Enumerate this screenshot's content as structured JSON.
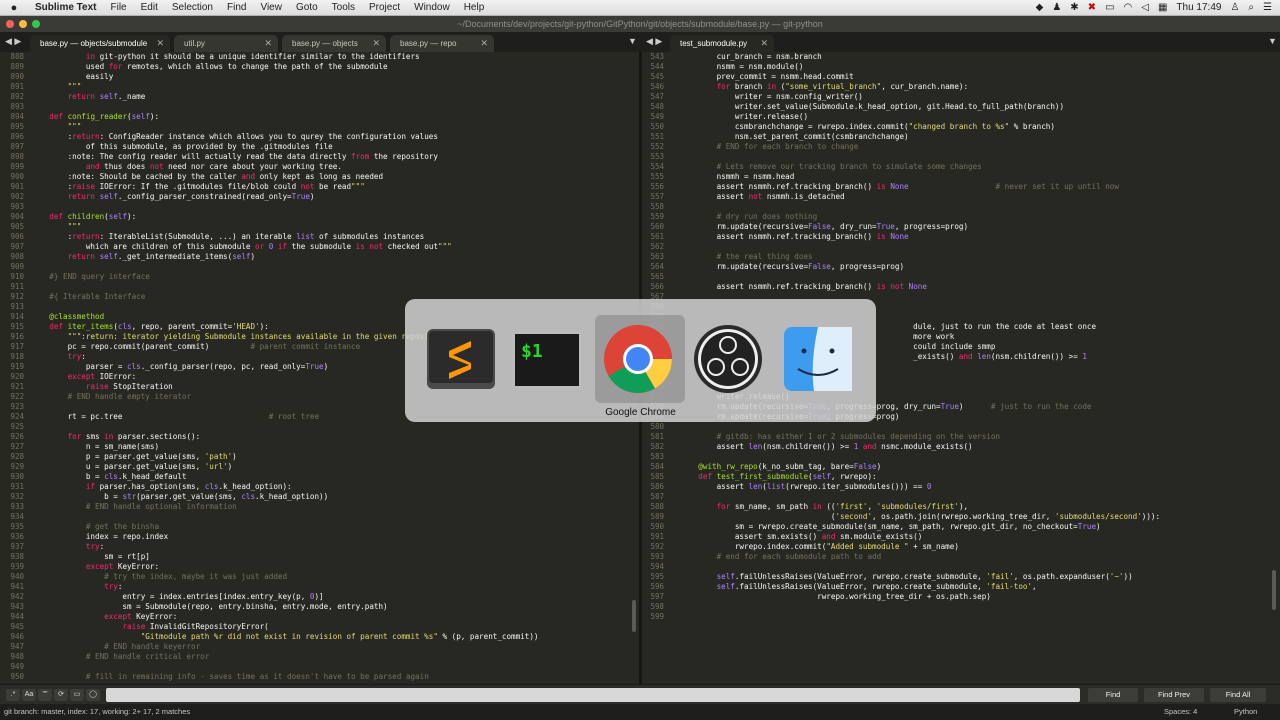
{
  "menubar": {
    "app": "Sublime Text",
    "items": [
      "File",
      "Edit",
      "Selection",
      "Find",
      "View",
      "Goto",
      "Tools",
      "Project",
      "Window",
      "Help"
    ],
    "clock": "Thu 17:49"
  },
  "window": {
    "title": "~/Documents/dev/projects/git-python/GitPython/git/objects/submodule/base.py — git-python"
  },
  "tabs_left": [
    {
      "label": "base.py — objects/submodule"
    },
    {
      "label": "util.py"
    },
    {
      "label": "base.py — objects"
    },
    {
      "label": "base.py — repo"
    }
  ],
  "tabs_right": [
    {
      "label": "test_submodule.py"
    }
  ],
  "left_lines": [
    {
      "n": "888",
      "t": "            in git-python it should be a unique identifier similar to the identifiers"
    },
    {
      "n": "889",
      "t": "            used for remotes, which allows to change the path of the submodule"
    },
    {
      "n": "890",
      "t": "            easily"
    },
    {
      "n": "891",
      "t": "        \"\"\""
    },
    {
      "n": "892",
      "t": "        return self._name"
    },
    {
      "n": "893",
      "t": ""
    },
    {
      "n": "894",
      "t": "    def config_reader(self):"
    },
    {
      "n": "895",
      "t": "        \"\"\""
    },
    {
      "n": "896",
      "t": "        :return: ConfigReader instance which allows you to qurey the configuration values"
    },
    {
      "n": "897",
      "t": "            of this submodule, as provided by the .gitmodules file"
    },
    {
      "n": "898",
      "t": "        :note: The config reader will actually read the data directly from the repository"
    },
    {
      "n": "899",
      "t": "            and thus does not need nor care about your working tree."
    },
    {
      "n": "900",
      "t": "        :note: Should be cached by the caller and only kept as long as needed"
    },
    {
      "n": "901",
      "t": "        :raise IOError: If the .gitmodules file/blob could not be read\"\"\""
    },
    {
      "n": "902",
      "t": "        return self._config_parser_constrained(read_only=True)"
    },
    {
      "n": "903",
      "t": ""
    },
    {
      "n": "904",
      "t": "    def children(self):"
    },
    {
      "n": "905",
      "t": "        \"\"\""
    },
    {
      "n": "906",
      "t": "        :return: IterableList(Submodule, ...) an iterable list of submodules instances"
    },
    {
      "n": "907",
      "t": "            which are children of this submodule or 0 if the submodule is not checked out\"\"\""
    },
    {
      "n": "908",
      "t": "        return self._get_intermediate_items(self)"
    },
    {
      "n": "909",
      "t": ""
    },
    {
      "n": "910",
      "t": "    #} END query interface"
    },
    {
      "n": "911",
      "t": ""
    },
    {
      "n": "912",
      "t": "    #{ Iterable Interface"
    },
    {
      "n": "913",
      "t": ""
    },
    {
      "n": "914",
      "t": "    @classmethod"
    },
    {
      "n": "915",
      "t": "    def iter_items(cls, repo, parent_commit='HEAD'):"
    },
    {
      "n": "916",
      "t": "        \"\"\":return: iterator yielding Submodule instances available in the given repository\"\"\""
    },
    {
      "n": "917",
      "t": "        pc = repo.commit(parent_commit)         # parent commit instance"
    },
    {
      "n": "918",
      "t": "        try:"
    },
    {
      "n": "919",
      "t": "            parser = cls._config_parser(repo, pc, read_only=True)"
    },
    {
      "n": "920",
      "t": "        except IOError:"
    },
    {
      "n": "921",
      "t": "            raise StopIteration"
    },
    {
      "n": "922",
      "t": "        # END handle empty iterator"
    },
    {
      "n": "923",
      "t": ""
    },
    {
      "n": "924",
      "t": "        rt = pc.tree                                # root tree"
    },
    {
      "n": "925",
      "t": ""
    },
    {
      "n": "926",
      "t": "        for sms in parser.sections():"
    },
    {
      "n": "927",
      "t": "            n = sm_name(sms)"
    },
    {
      "n": "928",
      "t": "            p = parser.get_value(sms, 'path')"
    },
    {
      "n": "929",
      "t": "            u = parser.get_value(sms, 'url')"
    },
    {
      "n": "930",
      "t": "            b = cls.k_head_default"
    },
    {
      "n": "931",
      "t": "            if parser.has_option(sms, cls.k_head_option):"
    },
    {
      "n": "932",
      "t": "                b = str(parser.get_value(sms, cls.k_head_option))"
    },
    {
      "n": "933",
      "t": "            # END handle optional information"
    },
    {
      "n": "934",
      "t": ""
    },
    {
      "n": "935",
      "t": "            # get the binsha"
    },
    {
      "n": "936",
      "t": "            index = repo.index"
    },
    {
      "n": "937",
      "t": "            try:"
    },
    {
      "n": "938",
      "t": "                sm = rt[p]"
    },
    {
      "n": "939",
      "t": "            except KeyError:"
    },
    {
      "n": "940",
      "t": "                # try the index, maybe it was just added"
    },
    {
      "n": "941",
      "t": "                try:"
    },
    {
      "n": "942",
      "t": "                    entry = index.entries[index.entry_key(p, 0)]"
    },
    {
      "n": "943",
      "t": "                    sm = Submodule(repo, entry.binsha, entry.mode, entry.path)"
    },
    {
      "n": "944",
      "t": "                except KeyError:"
    },
    {
      "n": "945",
      "t": "                    raise InvalidGitRepositoryError("
    },
    {
      "n": "946",
      "t": "                        \"Gitmodule path %r did not exist in revision of parent commit %s\" % (p, parent_commit))"
    },
    {
      "n": "947",
      "t": "                # END handle keyerror"
    },
    {
      "n": "948",
      "t": "            # END handle critical error"
    },
    {
      "n": "949",
      "t": ""
    },
    {
      "n": "950",
      "t": "            # fill in remaining info - saves time as it doesn't have to be parsed again"
    }
  ],
  "right_lines": [
    {
      "n": "543",
      "t": "        cur_branch = nsm.branch"
    },
    {
      "n": "544",
      "t": "        nsmm = nsm.module()"
    },
    {
      "n": "545",
      "t": "        prev_commit = nsmm.head.commit"
    },
    {
      "n": "546",
      "t": "        for branch in (\"some_virtual_branch\", cur_branch.name):"
    },
    {
      "n": "547",
      "t": "            writer = nsm.config_writer()"
    },
    {
      "n": "548",
      "t": "            writer.set_value(Submodule.k_head_option, git.Head.to_full_path(branch))"
    },
    {
      "n": "549",
      "t": "            writer.release()"
    },
    {
      "n": "550",
      "t": "            csmbranchchange = rwrepo.index.commit(\"changed branch to %s\" % branch)"
    },
    {
      "n": "551",
      "t": "            nsm.set_parent_commit(csmbranchchange)"
    },
    {
      "n": "552",
      "t": "        # END for each branch to change"
    },
    {
      "n": "553",
      "t": ""
    },
    {
      "n": "554",
      "t": "        # Lets remove our tracking branch to simulate some changes"
    },
    {
      "n": "555",
      "t": "        nsmmh = nsmm.head"
    },
    {
      "n": "556",
      "t": "        assert nsmmh.ref.tracking_branch() is None                   # never set it up until now"
    },
    {
      "n": "557",
      "t": "        assert not nsmmh.is_detached"
    },
    {
      "n": "558",
      "t": ""
    },
    {
      "n": "559",
      "t": "        # dry run does nothing"
    },
    {
      "n": "560",
      "t": "        rm.update(recursive=False, dry_run=True, progress=prog)"
    },
    {
      "n": "561",
      "t": "        assert nsmmh.ref.tracking_branch() is None"
    },
    {
      "n": "562",
      "t": ""
    },
    {
      "n": "563",
      "t": "        # the real thing does"
    },
    {
      "n": "564",
      "t": "        rm.update(recursive=False, progress=prog)"
    },
    {
      "n": "565",
      "t": ""
    },
    {
      "n": "566",
      "t": "        assert nsmmh.ref.tracking_branch() is not None"
    },
    {
      "n": "567",
      "t": ""
    },
    {
      "n": "568",
      "t": ""
    },
    {
      "n": "569",
      "t": ""
    },
    {
      "n": "570",
      "t": "                                                   dule, just to run the code at least once"
    },
    {
      "n": "571",
      "t": "                                                   more work"
    },
    {
      "n": "572",
      "t": "                                                   could include smmp"
    },
    {
      "n": "573",
      "t": "                                                   _exists() and len(nsm.children()) >= 1"
    },
    {
      "n": "574",
      "t": ""
    },
    {
      "n": "575",
      "t": ""
    },
    {
      "n": "576",
      "t": ""
    },
    {
      "n": "577",
      "t": "        writer.release()"
    },
    {
      "n": "578",
      "t": "        rm.update(recursive=True, progress=prog, dry_run=True)      # just to run the code"
    },
    {
      "n": "579",
      "t": "        rm.update(recursive=True, progress=prog)"
    },
    {
      "n": "580",
      "t": ""
    },
    {
      "n": "581",
      "t": "        # gitdb: has either 1 or 2 submodules depending on the version"
    },
    {
      "n": "582",
      "t": "        assert len(nsm.children()) >= 1 and nsmc.module_exists()"
    },
    {
      "n": "583",
      "t": ""
    },
    {
      "n": "584",
      "t": "    @with_rw_repo(k_no_subm_tag, bare=False)"
    },
    {
      "n": "585",
      "t": "    def test_first_submodule(self, rwrepo):"
    },
    {
      "n": "586",
      "t": "        assert len(list(rwrepo.iter_submodules())) == 0"
    },
    {
      "n": "587",
      "t": ""
    },
    {
      "n": "588",
      "t": "        for sm_name, sm_path in (('first', 'submodules/first'),"
    },
    {
      "n": "589",
      "t": "                                 ('second', os.path.join(rwrepo.working_tree_dir, 'submodules/second'))):"
    },
    {
      "n": "590",
      "t": "            sm = rwrepo.create_submodule(sm_name, sm_path, rwrepo.git_dir, no_checkout=True)"
    },
    {
      "n": "591",
      "t": "            assert sm.exists() and sm.module_exists()"
    },
    {
      "n": "592",
      "t": "            rwrepo.index.commit(\"Added submodule \" + sm_name)"
    },
    {
      "n": "593",
      "t": "        # end for each submodule path to add"
    },
    {
      "n": "594",
      "t": ""
    },
    {
      "n": "595",
      "t": "        self.failUnlessRaises(ValueError, rwrepo.create_submodule, 'fail', os.path.expanduser('~'))"
    },
    {
      "n": "596",
      "t": "        self.failUnlessRaises(ValueError, rwrepo.create_submodule, 'fail-too',"
    },
    {
      "n": "597",
      "t": "                              rwrepo.working_tree_dir + os.path.sep)"
    },
    {
      "n": "598",
      "t": ""
    },
    {
      "n": "599",
      "t": ""
    }
  ],
  "switcher": {
    "selected_label": "Google Chrome",
    "apps": [
      "sublime-text-icon",
      "terminal-icon",
      "chrome-icon",
      "obs-icon",
      "finder-icon"
    ]
  },
  "findbar": {
    "find_what": "",
    "find": "Find",
    "find_prev": "Find Prev",
    "find_all": "Find All",
    "opt_regex": ".*",
    "opt_case": "Aa",
    "opt_word": "\"\"",
    "opt_wrap": "⟳",
    "opt_sel": "▭",
    "opt_hl": "◯"
  },
  "status": {
    "left": "git branch: master, index: 17, working: 2+ 17, 2 matches",
    "spaces": "Spaces: 4",
    "syntax": "Python"
  },
  "colors": {
    "bg": "#272822",
    "keyword": "#f92672",
    "string": "#e6db74",
    "comment": "#75715e",
    "function": "#a6e22e",
    "number": "#ae81ff",
    "builtin": "#66d9ef"
  }
}
